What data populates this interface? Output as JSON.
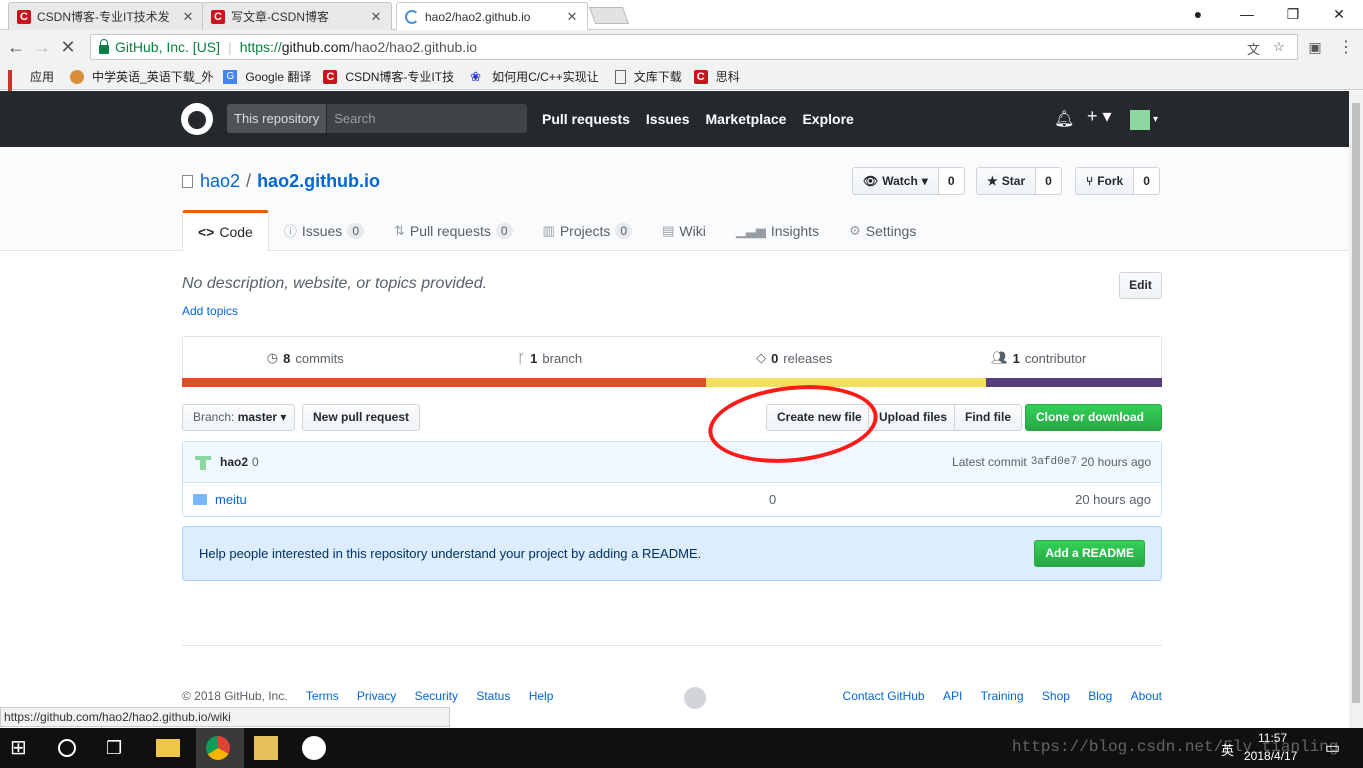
{
  "browser": {
    "tabs": [
      {
        "title": "CSDN博客-专业IT技术发",
        "icon": "csdn-icon"
      },
      {
        "title": "写文章-CSDN博客",
        "icon": "csdn-icon"
      },
      {
        "title": "hao2/hao2.github.io",
        "icon": "loading-spinner"
      }
    ],
    "ev_cert": "GitHub, Inc. [US]",
    "url_protocol": "https://",
    "url_host": "github.com",
    "url_path": "/hao2/hao2.github.io",
    "bookmarks": [
      {
        "label": "应用",
        "icon": "apps-icon"
      },
      {
        "label": "中学英语_英语下载_外",
        "icon": "site-icon"
      },
      {
        "label": "Google 翻译",
        "icon": "translate-icon"
      },
      {
        "label": "CSDN博客-专业IT技",
        "icon": "csdn-icon"
      },
      {
        "label": "如何用C/C++实现让",
        "icon": "baidu-icon"
      },
      {
        "label": "文库下载",
        "icon": "page-icon"
      },
      {
        "label": "思科",
        "icon": "csdn-icon"
      }
    ],
    "status_url": "https://github.com/hao2/hao2.github.io/wiki"
  },
  "github": {
    "scope_label": "This repository",
    "search_placeholder": "Search",
    "nav": [
      "Pull requests",
      "Issues",
      "Marketplace",
      "Explore"
    ],
    "owner": "hao2",
    "repo": "hao2.github.io",
    "watch": {
      "label": "Watch",
      "count": "0"
    },
    "star": {
      "label": "Star",
      "count": "0"
    },
    "fork": {
      "label": "Fork",
      "count": "0"
    },
    "tabs": [
      {
        "label": "Code",
        "count": ""
      },
      {
        "label": "Issues",
        "count": "0"
      },
      {
        "label": "Pull requests",
        "count": "0"
      },
      {
        "label": "Projects",
        "count": "0"
      },
      {
        "label": "Wiki",
        "count": ""
      },
      {
        "label": "Insights",
        "count": ""
      },
      {
        "label": "Settings",
        "count": ""
      }
    ],
    "description": "No description, website, or topics provided.",
    "add_topics": "Add topics",
    "edit": "Edit",
    "summary": {
      "commits_num": "8",
      "commits_label": "commits",
      "branch_num": "1",
      "branch_label": "branch",
      "releases_num": "0",
      "releases_label": "releases",
      "contributor_num": "1",
      "contributor_label": "contributor"
    },
    "lang_colors": [
      "#e34c26",
      "#f1e05a",
      "#563d7c"
    ],
    "lang_fractions": [
      0.535,
      0.285,
      0.18
    ],
    "branch_prefix": "Branch:",
    "branch_name": "master",
    "new_pr": "New pull request",
    "create_file": "Create new file",
    "upload": "Upload files",
    "find": "Find file",
    "clone": "Clone or download",
    "commit": {
      "author": "hao2",
      "message": "0",
      "latest_label": "Latest commit",
      "sha": "3afd0e7",
      "age": "20 hours ago"
    },
    "files": [
      {
        "name": "meitu",
        "message": "0",
        "age": "20 hours ago"
      }
    ],
    "readme_text": "Help people interested in this repository understand your project by adding a README.",
    "readme_btn": "Add a README",
    "footer": {
      "copyright": "© 2018 GitHub, Inc.",
      "left_links": [
        "Terms",
        "Privacy",
        "Security",
        "Status",
        "Help"
      ],
      "right_links": [
        "Contact GitHub",
        "API",
        "Training",
        "Shop",
        "Blog",
        "About"
      ]
    }
  },
  "taskbar": {
    "time": "11:57",
    "date": "2018/4/17",
    "ime": "英"
  },
  "watermark": "https://blog.csdn.net/Fly_tianling"
}
